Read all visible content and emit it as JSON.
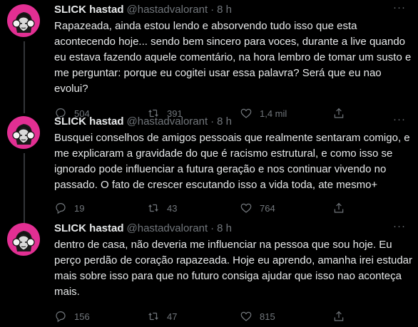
{
  "colors": {
    "background": "#000000",
    "primary_text": "#e7e9ea",
    "secondary_text": "#71767b",
    "avatar_bg": "#e22f93",
    "thread_line": "#333639"
  },
  "tweets": [
    {
      "name": "SLICK hastad",
      "handle": "@hastadvalorant",
      "dot": "·",
      "time": "8 h",
      "more": "···",
      "text": "Rapazeada, ainda estou lendo e absorvendo tudo isso que esta\nacontecendo hoje... sendo bem sincero para voces, durante a live quando\neu estava fazendo aquele comentário, na hora lembro de tomar um susto e\nme perguntar: porque eu cogitei usar essa palavra? Será que eu nao evolui?",
      "replies": "504",
      "retweets": "391",
      "likes": "1,4 mil",
      "icons": [
        "reply-icon",
        "retweet-icon",
        "like-icon",
        "share-icon"
      ]
    },
    {
      "name": "SLICK hastad",
      "handle": "@hastadvalorant",
      "dot": "·",
      "time": "8 h",
      "more": "···",
      "text": "Busquei conselhos de amigos pessoais que realmente sentaram comigo, e\nme explicaram a gravidade do que é racismo estrutural, e como isso se\nignorado pode influenciar a futura geração e nos continuar vivendo no\npassado. O fato de crescer escutando isso a vida toda, ate mesmo+",
      "replies": "19",
      "retweets": "43",
      "likes": "764",
      "icons": [
        "reply-icon",
        "retweet-icon",
        "like-icon",
        "share-icon"
      ]
    },
    {
      "name": "SLICK hastad",
      "handle": "@hastadvalorant",
      "dot": "·",
      "time": "8 h",
      "more": "···",
      "text": "dentro de casa, não deveria me influenciar na pessoa que sou hoje. Eu\nperço perdão de coração rapazeada. Hoje eu aprendo, amanha irei estudar\nmais sobre isso para que no futuro consiga ajudar que isso nao aconteça\nmais.",
      "replies": "156",
      "retweets": "47",
      "likes": "815",
      "icons": [
        "reply-icon",
        "retweet-icon",
        "like-icon",
        "share-icon"
      ]
    }
  ]
}
